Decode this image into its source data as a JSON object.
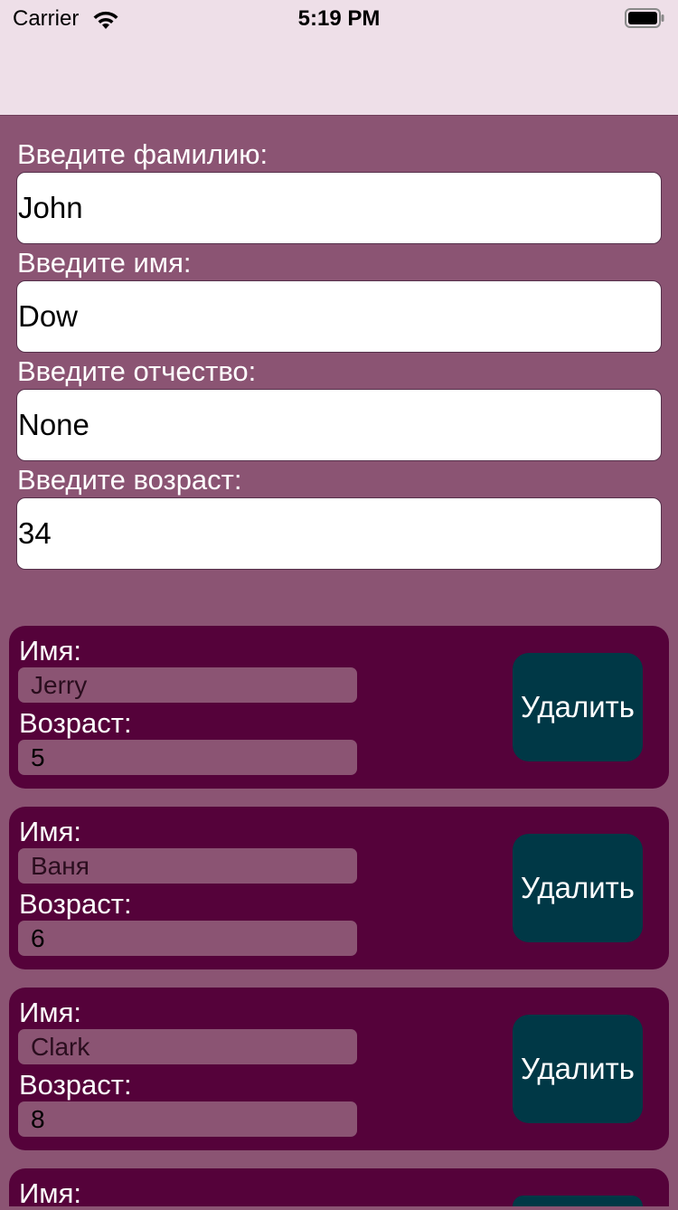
{
  "status_bar": {
    "carrier": "Carrier",
    "time": "5:19 PM",
    "icons": [
      "wifi-icon",
      "battery-icon"
    ]
  },
  "form": {
    "surname": {
      "label": "Введите фамилию:",
      "value": "John"
    },
    "first_name": {
      "label": "Введите имя:",
      "value": "Dow"
    },
    "patronymic": {
      "label": "Введите отчество:",
      "value": "None"
    },
    "age": {
      "label": "Введите возраст:",
      "value": "34"
    }
  },
  "children": [
    {
      "name_label": "Имя:",
      "name": "Jerry",
      "age_label": "Возраст:",
      "age": "5",
      "delete_label": "Удалить"
    },
    {
      "name_label": "Имя:",
      "name": "Ваня",
      "age_label": "Возраст:",
      "age": "6",
      "delete_label": "Удалить"
    },
    {
      "name_label": "Имя:",
      "name": "Clark",
      "age_label": "Возраст:",
      "age": "8",
      "delete_label": "Удалить"
    },
    {
      "name_label": "Имя:"
    }
  ],
  "colors": {
    "top_background": "#eedfe8",
    "page_background": "#8b5473",
    "card_background": "#55023a",
    "delete_button": "#003846"
  }
}
